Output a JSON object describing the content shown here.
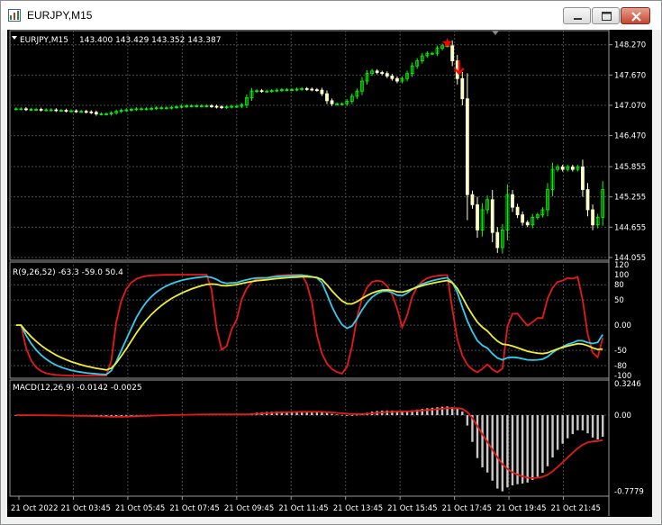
{
  "window": {
    "title": "EURJPY,M15",
    "icon": "chart-window-icon",
    "buttons": [
      "minimize-icon",
      "maximize-icon",
      "close-icon"
    ]
  },
  "colors": {
    "background": "#000000",
    "grid": "#4a4a4a",
    "bull_candle": "#00ff00",
    "bear_candle": "#ffffcc",
    "text": "#ffffff",
    "marker": "#ff0000",
    "line_red": "#e61a1a",
    "line_cyan": "#33ccee",
    "line_yellow": "#eeee33",
    "macd_hist": "#c8c8c8",
    "macd_signal": "#e61a1a"
  },
  "main_panel": {
    "header_symbol": "EURJPY,M15",
    "header_ohlc": "143.400 143.429 143.352 143.387",
    "price_ticks": [
      "148.270",
      "147.670",
      "147.070",
      "146.470",
      "145.855",
      "145.255",
      "144.655",
      "144.055"
    ],
    "price_tick_values": [
      148.27,
      147.67,
      147.07,
      146.47,
      145.855,
      145.255,
      144.655,
      144.055
    ],
    "price_range": [
      144.0,
      148.55
    ]
  },
  "indicator_panel": {
    "label": "R(9,26,52) -63.3 -59.0 50.4",
    "ticks": [
      "120",
      "100",
      "80",
      "50",
      "0.00",
      "-50",
      "-80",
      "-100"
    ],
    "tick_values": [
      120,
      100,
      80,
      50,
      0,
      -50,
      -80,
      -100
    ],
    "range": [
      -105,
      125
    ]
  },
  "macd_panel": {
    "label": "MACD(12,26,9) -0.0142 -0.0025",
    "ticks": [
      "0.3246",
      "0.00",
      "-0.7779"
    ],
    "tick_values": [
      0.3246,
      0,
      -0.7779
    ],
    "range": [
      -0.83,
      0.36
    ]
  },
  "time_axis": {
    "labels": [
      "21 Oct 2022",
      "21 Oct 03:45",
      "21 Oct 05:45",
      "21 Oct 07:45",
      "21 Oct 09:45",
      "21 Oct 11:45",
      "21 Oct 13:45",
      "21 Oct 15:45",
      "21 Oct 17:45",
      "21 Oct 19:45",
      "21 Oct 21:45"
    ]
  },
  "chart_data": {
    "type": "candlestick",
    "symbol": "EURJPY",
    "timeframe": "M15",
    "candles_close": [
      147.0,
      147.0,
      146.99,
      146.99,
      146.99,
      146.98,
      146.98,
      146.98,
      146.97,
      146.97,
      146.96,
      146.96,
      146.95,
      146.95,
      146.94,
      146.93,
      146.9,
      146.9,
      146.9,
      146.92,
      146.95,
      146.97,
      146.98,
      146.99,
      147.0,
      147.0,
      147.0,
      147.01,
      147.02,
      147.02,
      147.02,
      147.03,
      147.04,
      147.05,
      147.06,
      147.06,
      147.06,
      147.06,
      147.06,
      147.05,
      147.04,
      147.03,
      147.04,
      147.05,
      147.05,
      147.08,
      147.22,
      147.35,
      147.36,
      147.35,
      147.35,
      147.36,
      147.37,
      147.38,
      147.38,
      147.38,
      147.39,
      147.4,
      147.39,
      147.38,
      147.37,
      147.3,
      147.16,
      147.1,
      147.1,
      147.1,
      147.15,
      147.25,
      147.35,
      147.55,
      147.7,
      147.75,
      147.72,
      147.7,
      147.65,
      147.6,
      147.55,
      147.6,
      147.7,
      147.85,
      147.95,
      148.05,
      148.1,
      148.1,
      148.2,
      148.25,
      148.25,
      147.95,
      147.6,
      147.2,
      145.3,
      145.1,
      144.6,
      145.0,
      145.2,
      144.55,
      144.25,
      144.6,
      145.3,
      145.05,
      144.9,
      144.75,
      144.7,
      144.85,
      144.9,
      145.0,
      145.4,
      145.8,
      145.85,
      145.8,
      145.85,
      145.8,
      145.85,
      145.4,
      145.0,
      144.7,
      144.85,
      145.4
    ],
    "price_axis": [
      144.055,
      148.27
    ],
    "indicator_series": [
      {
        "name": "R(9)",
        "color": "#e61a1a"
      },
      {
        "name": "R(26)",
        "color": "#33ccee"
      },
      {
        "name": "R(52)",
        "color": "#eeee33"
      }
    ],
    "indicator_values_last": [
      -63.3,
      -59.0,
      50.4
    ],
    "macd_values_last": [
      -0.0142,
      -0.0025
    ],
    "markers": [
      {
        "type": "star",
        "near": "peak",
        "price": 148.3
      },
      {
        "type": "arrow-down",
        "price": 147.75
      }
    ]
  }
}
